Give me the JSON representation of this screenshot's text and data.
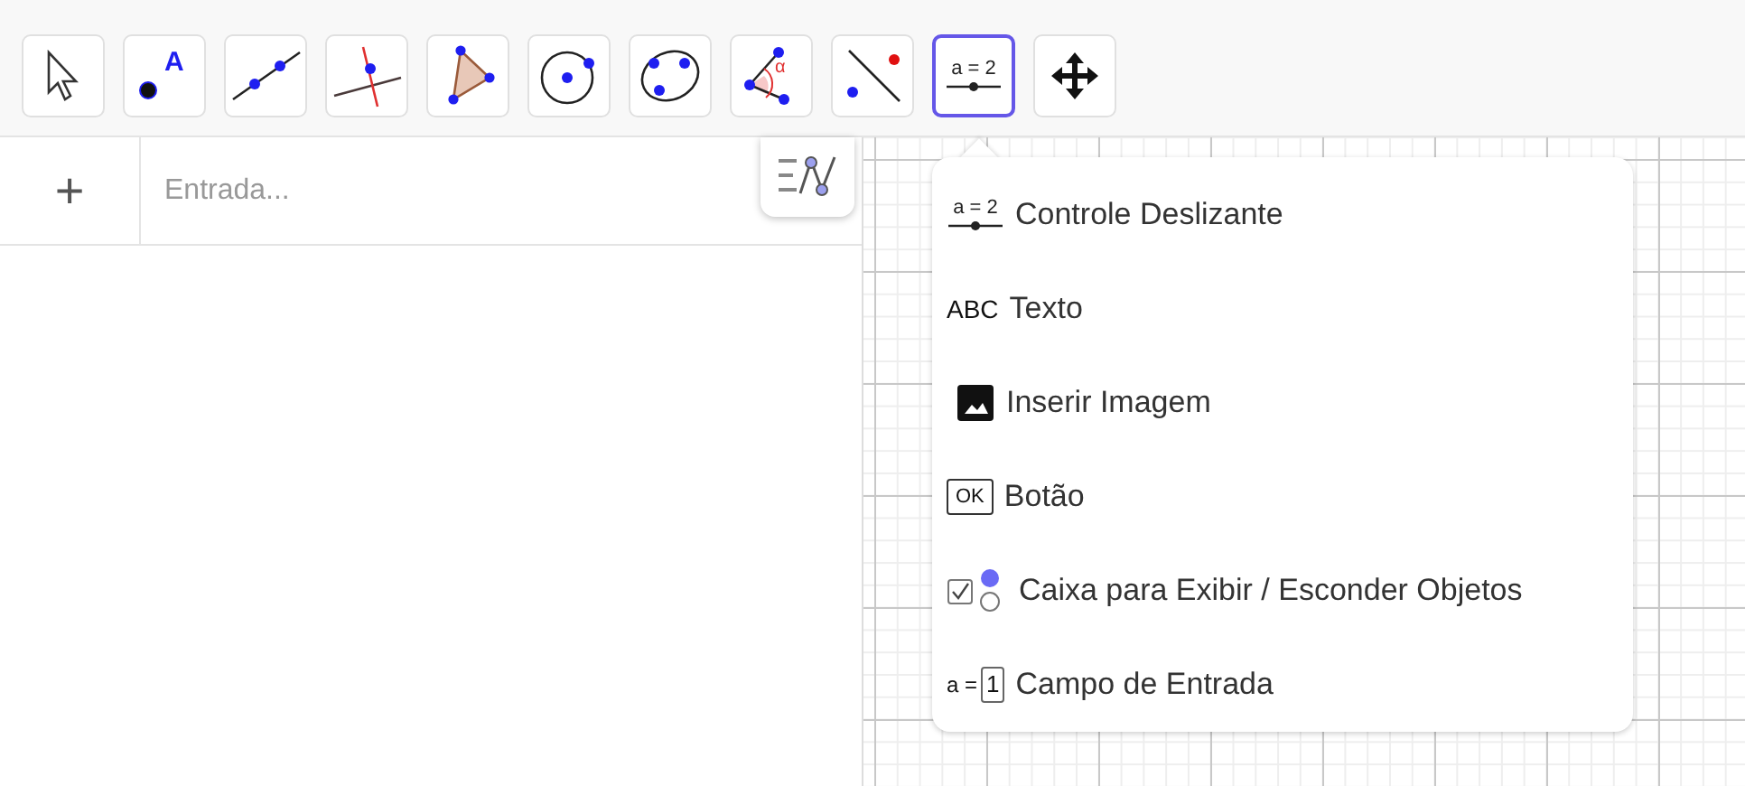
{
  "toolbar": {
    "tools": [
      {
        "kind": "move",
        "selected": false
      },
      {
        "kind": "point",
        "selected": false,
        "glyph": "A"
      },
      {
        "kind": "line",
        "selected": false
      },
      {
        "kind": "perpendicular",
        "selected": false
      },
      {
        "kind": "polygon",
        "selected": false
      },
      {
        "kind": "circle",
        "selected": false
      },
      {
        "kind": "conic",
        "selected": false
      },
      {
        "kind": "angle",
        "selected": false,
        "glyph": "α"
      },
      {
        "kind": "reflect",
        "selected": false
      },
      {
        "kind": "slider",
        "selected": true,
        "glyph": "a = 2"
      },
      {
        "kind": "pan",
        "selected": false
      }
    ]
  },
  "algebra": {
    "add_symbol": "+",
    "input": {
      "placeholder": "Entrada..."
    }
  },
  "menu": {
    "items": [
      {
        "kind": "slider",
        "glyph": "a = 2",
        "label": "Controle Deslizante"
      },
      {
        "kind": "text",
        "glyph": "ABC",
        "label": "Texto"
      },
      {
        "kind": "image",
        "label": "Inserir Imagem"
      },
      {
        "kind": "button",
        "glyph": "OK",
        "label": "Botão"
      },
      {
        "kind": "checkbox",
        "label": "Caixa para Exibir / Esconder Objetos"
      },
      {
        "kind": "inputbox",
        "glyph": "a =",
        "glyph2": "1",
        "label": "Campo de Entrada"
      }
    ]
  }
}
